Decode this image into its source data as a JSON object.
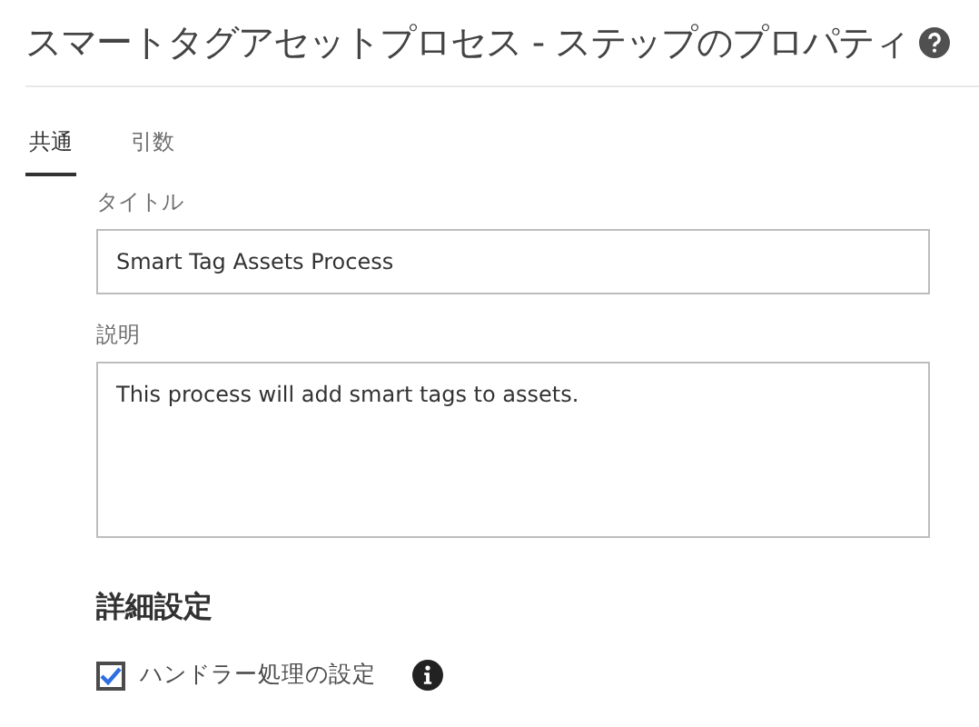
{
  "window": {
    "title": "スマートタグアセットプロセス - ステップのプロパティ"
  },
  "tabs": [
    {
      "label": "共通",
      "selected": true
    },
    {
      "label": "引数",
      "selected": false
    }
  ],
  "fields": [
    {
      "kind": "input",
      "label": "タイトル",
      "value": "Smart Tag Assets Process"
    },
    {
      "kind": "textarea",
      "label": "説明",
      "value": "This process will add smart tags to assets."
    }
  ],
  "section": {
    "title": "詳細設定"
  },
  "options": [
    {
      "label": "ハンドラー処理の設定",
      "checked": true
    }
  ]
}
